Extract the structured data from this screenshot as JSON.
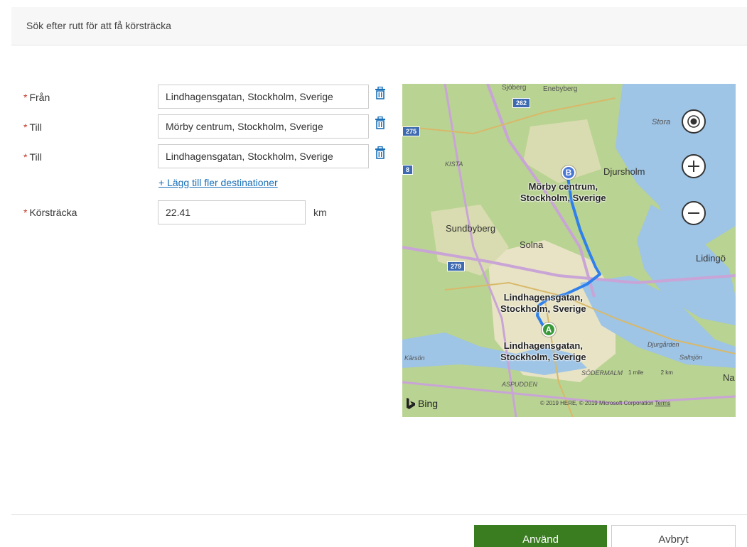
{
  "header": {
    "title": "Sök efter rutt för att få körsträcka"
  },
  "form": {
    "required_marker": "*",
    "from_label": "Från",
    "from_value": "Lindhagensgatan, Stockholm, Sverige",
    "to_label_1": "Till",
    "to_value_1": "Mörby centrum, Stockholm, Sverige",
    "to_label_2": "Till",
    "to_value_2": "Lindhagensgatan, Stockholm, Sverige",
    "add_link": "+ Lägg till fler destinationer",
    "distance_label": "Körsträcka",
    "distance_value": "22.41",
    "distance_unit": "km"
  },
  "map": {
    "labels": {
      "sjoberg": "Sjöberg",
      "enebyberg": "Enebyberg",
      "stora": "Stora",
      "kista": "KISTA",
      "djursholm": "Djursholm",
      "sundbyberg": "Sundbyberg",
      "solna": "Solna",
      "lidingo": "Lidingö",
      "djurgarden": "Djurgården",
      "saltsjon": "Saltsjön",
      "karson": "Kärsön",
      "sodermalm": "SÖDERMALM",
      "aspudden": "ASPUDDEN",
      "na": "Na"
    },
    "highways": {
      "h262": "262",
      "h275": "275",
      "h279": "279",
      "h8": "8"
    },
    "place_b_line1": "Mörby centrum,",
    "place_b_line2": "Stockholm, Sverige",
    "place_a1_line1": "Lindhagensgatan,",
    "place_a1_line2": "Stockholm, Sverige",
    "place_a2_line1": "Lindhagensgatan,",
    "place_a2_line2": "Stockholm, Sverige",
    "marker_a": "A",
    "marker_b": "B",
    "bing": "Bing",
    "copyright": "© 2019 HERE, © 2019 Microsoft Corporation",
    "terms": "Terms",
    "scale_mile": "1 mile",
    "scale_km": "2 km"
  },
  "buttons": {
    "apply": "Använd",
    "cancel": "Avbryt"
  },
  "colors": {
    "accent_green": "#3a7d20",
    "link_blue": "#1a70b8",
    "required_red": "#c0392b",
    "route_blue": "#2f80ed"
  }
}
